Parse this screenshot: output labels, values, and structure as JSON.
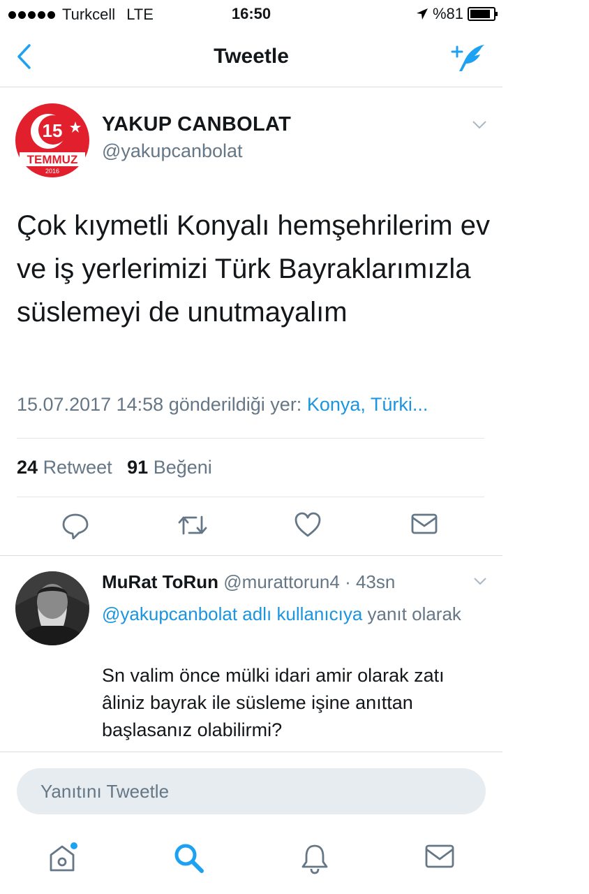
{
  "status_bar": {
    "carrier": "Turkcell",
    "network": "LTE",
    "time": "16:50",
    "battery": "%81"
  },
  "nav": {
    "title": "Tweetle",
    "back_icon": "chevron-left-icon",
    "compose_icon": "compose-tweet-icon"
  },
  "tweet": {
    "avatar_badge": {
      "number": "15",
      "text": "TEMMUZ",
      "year": "2016"
    },
    "author_name": "YAKUP CANBOLAT",
    "author_handle": "@yakupcanbolat",
    "text": "Çok kıymetli Konyalı hemşehrilerim ev ve iş yerlerimizi Türk Bayraklarımızla süslemeyi de unutmayalım",
    "timestamp": "15.07.2017 14:58 gönderildiği yer:",
    "location": "Konya, Türki...",
    "retweet_count": "24",
    "retweet_label": "Retweet",
    "like_count": "91",
    "like_label": "Beğeni",
    "actions": [
      "reply-icon",
      "retweet-icon",
      "like-icon",
      "direct-message-icon"
    ]
  },
  "reply": {
    "author_name": "MuRat ToRun",
    "author_handle": "@murattorun4",
    "separator": " · ",
    "time": "43sn",
    "reply_to_mention": "@yakupcanbolat adlı kullanıcıya",
    "reply_to_suffix": "yanıt olarak",
    "text": "Sn valim önce mülki idari amir olarak zatı âliniz bayrak ile süsleme işine anıttan başlasanız olabilirmi?"
  },
  "reply_input": {
    "placeholder": "Yanıtını Tweetle"
  },
  "tab_bar": [
    "home-icon",
    "search-icon",
    "notifications-icon",
    "messages-icon"
  ],
  "colors": {
    "accent": "#1da1f2",
    "link": "#1b95e0",
    "secondary_text": "#657786",
    "badge_red": "#e2202d"
  }
}
